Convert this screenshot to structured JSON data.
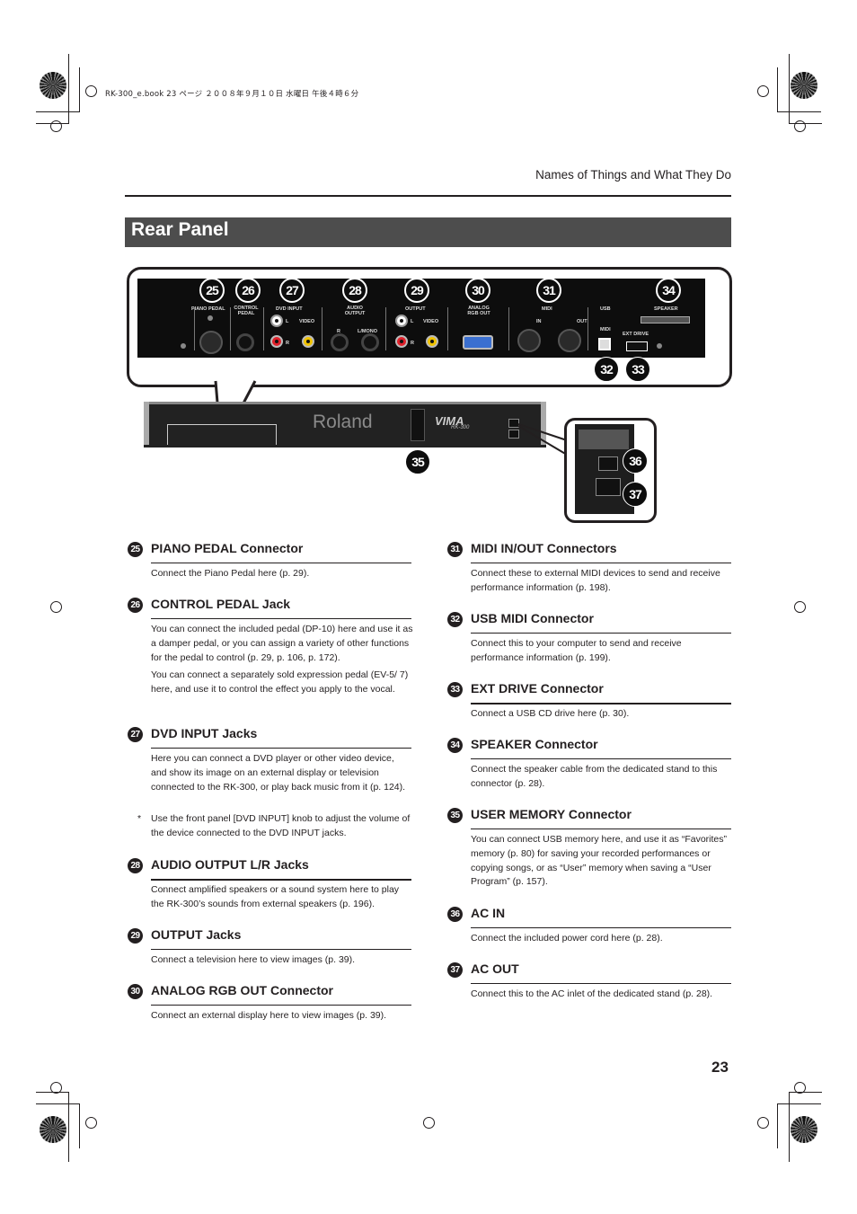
{
  "slug": "RK-300_e.book  23 ページ  ２００８年９月１０日  水曜日  午後４時６分",
  "running_head": "Names of Things and What They Do",
  "section_title": "Rear Panel",
  "page_number": "23",
  "diagram": {
    "callout_numbers": [
      "25",
      "26",
      "27",
      "28",
      "29",
      "30",
      "31",
      "34"
    ],
    "lower_numbers": [
      "32",
      "33"
    ],
    "device_number": "35",
    "inset_numbers": [
      "36",
      "37"
    ],
    "panel_labels": {
      "piano_pedal": "PIANO PEDAL",
      "control_pedal": "CONTROL PEDAL",
      "dvd_input": "DVD INPUT",
      "audio_output": "AUDIO OUTPUT",
      "output": "OUTPUT",
      "analog_rgb_out": "ANALOG RGB OUT",
      "midi": "MIDI",
      "usb": "USB",
      "speaker": "SPEAKER",
      "l": "L",
      "r": "R",
      "video": "VIDEO",
      "l_mono": "L/MONO",
      "in": "IN",
      "out": "OUT",
      "usb_midi": "MIDI",
      "ext_drive": "EXT DRIVE"
    },
    "brand": "Roland",
    "product": "VIMA",
    "model": "RK-300"
  },
  "left_column": [
    {
      "num": "25",
      "title": "PIANO PEDAL Connector",
      "paragraphs": [
        "Connect the Piano Pedal here (p. 29)."
      ]
    },
    {
      "num": "26",
      "title": "CONTROL PEDAL Jack",
      "paragraphs": [
        "You can connect the included pedal (DP-10) here and use it as a damper pedal, or you can assign a variety of other functions for the pedal to control (p. 29, p. 106, p. 172).",
        "You can connect a separately sold expression pedal (EV-5/ 7) here, and use it to control the effect you apply to the vocal."
      ]
    },
    {
      "num": "27",
      "title": "DVD INPUT Jacks",
      "paragraphs": [
        "Here you can connect a DVD player or other video device, and show its image on an external display or television connected to the RK-300, or play back music from it (p. 124)."
      ],
      "note": "Use the front panel [DVD INPUT] knob to adjust the volume of the device connected to the DVD INPUT jacks."
    },
    {
      "num": "28",
      "title": "AUDIO OUTPUT L/R Jacks",
      "paragraphs": [
        "Connect amplified speakers or a sound system here to play the RK-300’s sounds from external speakers (p. 196)."
      ]
    },
    {
      "num": "29",
      "title": "OUTPUT Jacks",
      "paragraphs": [
        "Connect a television here to view images (p. 39)."
      ]
    },
    {
      "num": "30",
      "title": "ANALOG RGB OUT Connector",
      "paragraphs": [
        "Connect an external display here to view images (p. 39)."
      ]
    }
  ],
  "right_column": [
    {
      "num": "31",
      "title": "MIDI IN/OUT Connectors",
      "paragraphs": [
        "Connect these to external MIDI devices to send and receive performance information (p. 198)."
      ]
    },
    {
      "num": "32",
      "title": "USB MIDI Connector",
      "paragraphs": [
        "Connect this to your computer to send and receive performance information (p. 199)."
      ]
    },
    {
      "num": "33",
      "title": "EXT DRIVE Connector",
      "paragraphs": [
        "Connect a USB CD drive here (p. 30)."
      ]
    },
    {
      "num": "34",
      "title": "SPEAKER Connector",
      "paragraphs": [
        "Connect the speaker cable from the dedicated stand to this connector (p. 28)."
      ]
    },
    {
      "num": "35",
      "title": "USER MEMORY Connector",
      "paragraphs": [
        "You can connect USB memory here, and use it as “Favorites” memory (p. 80) for saving your recorded performances or copying songs, or as “User” memory when saving a “User Program” (p. 157)."
      ]
    },
    {
      "num": "36",
      "title": "AC IN",
      "paragraphs": [
        "Connect the included power cord here (p. 28)."
      ]
    },
    {
      "num": "37",
      "title": "AC OUT",
      "paragraphs": [
        "Connect this to the AC inlet of the dedicated stand (p. 28)."
      ]
    }
  ]
}
